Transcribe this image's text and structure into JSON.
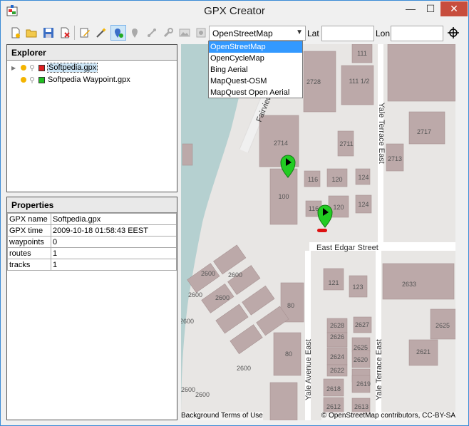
{
  "window": {
    "title": "GPX Creator",
    "minimize": "—",
    "maximize": "☐",
    "close": "✕"
  },
  "toolbar": {
    "icons": [
      "new-file-icon",
      "open-folder-icon",
      "save-icon",
      "close-file-icon",
      "edit-icon",
      "magic-wand-icon",
      "add-waypoint-icon",
      "waypoint-icon",
      "route-icon",
      "wrench-icon",
      "image-icon",
      "photo-icon",
      "delete-icon"
    ],
    "map_source": "OpenStreetMap",
    "lat_label": "Lat",
    "lat_value": "",
    "lon_label": "Lon",
    "lon_value": ""
  },
  "map_sources": [
    "OpenStreetMap",
    "OpenCycleMap",
    "Bing Aerial",
    "MapQuest-OSM",
    "MapQuest Open Aerial"
  ],
  "explorer": {
    "title": "Explorer",
    "files": [
      {
        "name": "Softpedia.gpx",
        "color": "#e02020"
      },
      {
        "name": "Softpedia Waypoint.gpx",
        "color": "#20c020"
      }
    ]
  },
  "properties": {
    "title": "Properties",
    "rows": [
      {
        "key": "GPX name",
        "value": "Softpedia.gpx"
      },
      {
        "key": "GPX time",
        "value": "2009-10-18 01:58:43 EEST"
      },
      {
        "key": "waypoints",
        "value": "0"
      },
      {
        "key": "routes",
        "value": "1"
      },
      {
        "key": "tracks",
        "value": "1"
      }
    ]
  },
  "map": {
    "streets": [
      "Fairview",
      "Yale Terrace East",
      "East Edgar Street",
      "Yale Avenue East",
      "Yale Terrace East"
    ],
    "building_labels": [
      "111",
      "2728",
      "111 1/2",
      "2717",
      "2714",
      "2711",
      "2713",
      "116",
      "120",
      "124",
      "100",
      "116",
      "120",
      "124",
      "121",
      "123",
      "2633",
      "2600",
      "2600",
      "2600",
      "2600",
      "2600",
      "80",
      "2628",
      "2627",
      "2626",
      "2625",
      "2625",
      "2624",
      "2621",
      "80",
      "2622",
      "2620",
      "2600",
      "2600",
      "2618",
      "2619",
      "2612",
      "2613",
      "2600"
    ],
    "attribution_left": "Background Terms of Use",
    "attribution_right": "© OpenStreetMap contributors, CC-BY-SA"
  },
  "colors": {
    "water": "#b5d0d0",
    "building": "#bca9a9",
    "land": "#e8e6e4",
    "waypoint": "#22cc22",
    "route": "#dd1111"
  }
}
